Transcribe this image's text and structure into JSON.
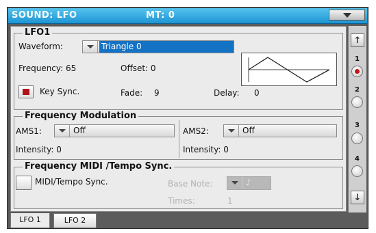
{
  "title": "SOUND: LFO",
  "mt": "MT: 0",
  "lfo1": {
    "legend": "LFO1",
    "waveform_label": "Waveform:",
    "waveform_value": "Triangle 0",
    "frequency": "Frequency: 65",
    "offset": "Offset: 0",
    "key_sync_label": "Key Sync.",
    "key_sync_checked": true,
    "fade": "Fade:",
    "fade_value": "9",
    "delay": "Delay:",
    "delay_value": "0"
  },
  "freq_mod": {
    "legend": "Frequency Modulation",
    "ams1_label": "AMS1:",
    "ams1_value": "Off",
    "ams2_label": "AMS2:",
    "ams2_value": "Off",
    "intensity1": "Intensity: 0",
    "intensity2": "Intensity: 0"
  },
  "midi_sync": {
    "legend": "Frequency MIDI /Tempo Sync.",
    "checkbox_label": "MIDI/Tempo Sync.",
    "checked": false,
    "base_note": "Base Note:",
    "note_icon": "eighth-note-icon",
    "times": "Times:",
    "times_value": "1"
  },
  "side": {
    "radios": [
      "1",
      "2",
      "3",
      "4"
    ],
    "selected": "1",
    "up_icon": "arrow-up-icon",
    "down_icon": "arrow-down-icon"
  },
  "tabs": [
    {
      "label": "LFO 1",
      "active": true
    },
    {
      "label": "LFO 2",
      "active": false
    }
  ],
  "colors": {
    "title_bar": "#1e95d3",
    "selection": "#1472c4",
    "check_red": "#b0141b"
  }
}
